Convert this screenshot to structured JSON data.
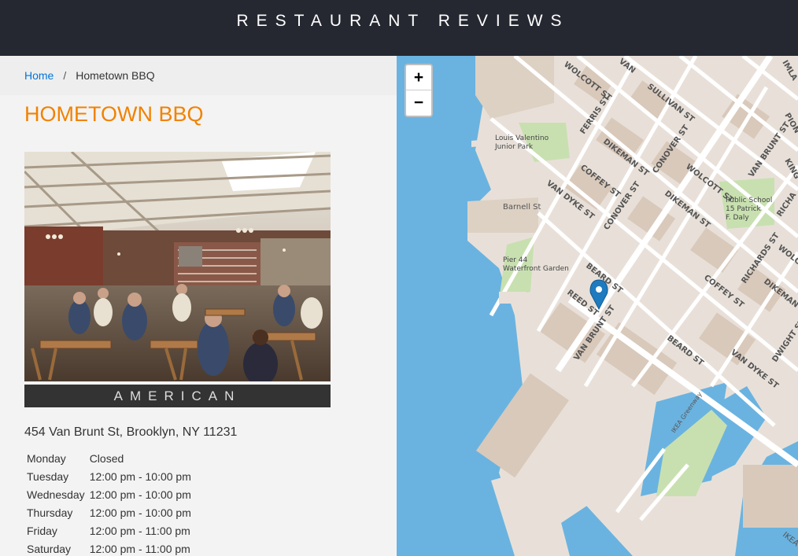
{
  "header": {
    "title": "RESTAURANT REVIEWS"
  },
  "breadcrumb": {
    "home": "Home",
    "separator": "/",
    "current": "Hometown BBQ"
  },
  "restaurant": {
    "name": "HOMETOWN BBQ",
    "cuisine": "AMERICAN",
    "address": "454 Van Brunt St, Brooklyn, NY 11231",
    "hours": [
      {
        "day": "Monday",
        "time": "Closed"
      },
      {
        "day": "Tuesday",
        "time": "12:00 pm - 10:00 pm"
      },
      {
        "day": "Wednesday",
        "time": "12:00 pm - 10:00 pm"
      },
      {
        "day": "Thursday",
        "time": "12:00 pm - 10:00 pm"
      },
      {
        "day": "Friday",
        "time": "12:00 pm - 11:00 pm"
      },
      {
        "day": "Saturday",
        "time": "12:00 pm - 11:00 pm"
      }
    ]
  },
  "map": {
    "zoom_in": "+",
    "zoom_out": "−",
    "streets": [
      "WOLCOTT ST",
      "VAN",
      "SULLIVAN ST",
      "FERRIS ST",
      "DIKEMAN ST",
      "CONOVER ST",
      "VAN BRUNT ST",
      "COFFEY ST",
      "WOLCOTT ST",
      "VAN DYKE ST",
      "CONOVER ST",
      "DIKEMAN ST",
      "Barnell St",
      "BEARD ST",
      "REED ST",
      "VAN BRUNT ST",
      "BEARD ST",
      "COFFEY ST",
      "RICHARDS ST",
      "DIKEMAN ST",
      "VAN DYKE ST",
      "DWIGHT ST",
      "IKEA Greenway",
      "IMLA",
      "PION",
      "KING",
      "RICHA",
      "WOLC",
      "IKEA"
    ],
    "places": [
      "Louis Valentino Junior Park",
      "Public School 15 Patrick F. Daly",
      "Pier 44 Waterfront Garden"
    ],
    "colors": {
      "water": "#6ab3e0",
      "land": "#e8e0d8",
      "building": "#d9c9bb",
      "park": "#c8e0b0",
      "road": "#ffffff",
      "marker": "#1e7bc0"
    }
  }
}
